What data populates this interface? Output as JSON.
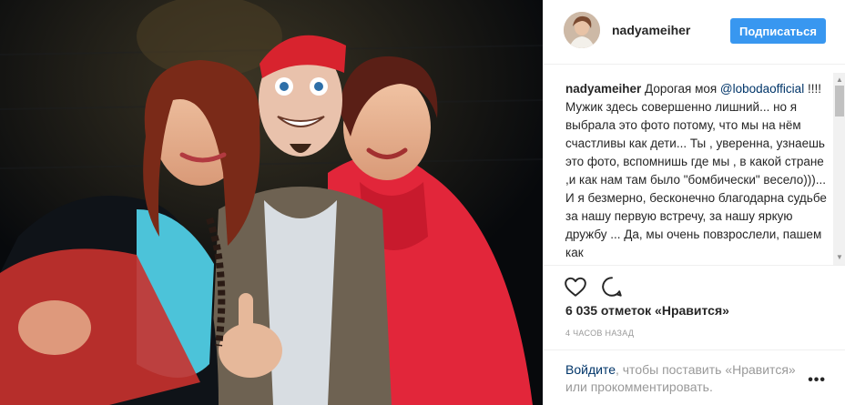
{
  "post": {
    "username": "nadyameiher",
    "follow_label": "Подписаться",
    "caption": {
      "username": "nadyameiher",
      "text_before": " Дорогая моя ",
      "mention": "@lobodaofficial",
      "text_after": " !!!! Мужик здесь совершенно лишний... но я выбрала это фото потому, что мы на нём счастливы как дети... Ты , уверенна, узнаешь это фото, вспомнишь где мы , в какой стране ,и как нам там было \"бомбически\" весело)))... И я безмерно, бесконечно благодарна судьбе за нашу первую встречу, за нашу яркую дружбу ... Да, мы очень повзрослели, пашем как"
    },
    "likes_text": "6 035 отметок «Нравится»",
    "timestamp": "4 ЧАСОВ НАЗАД",
    "login_link": "Войдите",
    "login_prompt_rest": ", чтобы поставить «Нравится» или прокомментировать.",
    "more_label": "•••",
    "icons": [
      "heart-icon",
      "comment-icon",
      "more-options-icon"
    ],
    "colors": {
      "accent": "#3897f0",
      "link": "#003569",
      "muted": "#999999",
      "text": "#262626"
    }
  }
}
